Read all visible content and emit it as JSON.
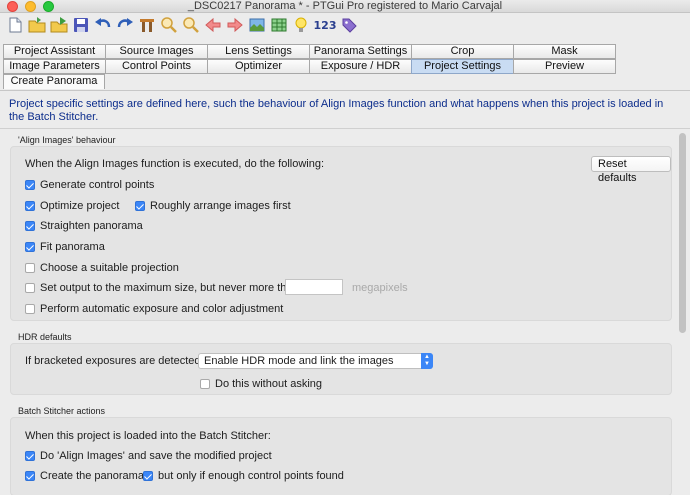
{
  "window": {
    "title": "_DSC0217 Panorama * - PTGui Pro registered to Mario Carvajal"
  },
  "toolbar": {
    "icons": [
      "new-document-icon",
      "open-folder-icon",
      "open-image-icon",
      "save-icon",
      "undo-icon",
      "redo-icon",
      "adjust-icon",
      "zoom-in-icon",
      "zoom-out-icon",
      "previous-icon",
      "next-icon",
      "panorama-editor-icon",
      "table-icon",
      "lightbulb-icon",
      "numbering-icon",
      "tag-icon"
    ],
    "numbering_label": "123"
  },
  "tabs": {
    "row1": [
      "Project Assistant",
      "Source Images",
      "Lens Settings",
      "Panorama Settings",
      "Crop",
      "Mask"
    ],
    "row2": [
      "Image Parameters",
      "Control Points",
      "Optimizer",
      "Exposure / HDR",
      "Project Settings",
      "Preview"
    ],
    "row3": [
      "Create Panorama"
    ]
  },
  "description": "Project specific settings are defined here, such the behaviour of Align Images function and what happens when this project is loaded in the Batch Stitcher.",
  "align": {
    "label": "'Align Images' behaviour",
    "heading": "When the Align Images function is executed, do the following:",
    "reset_button": "Reset defaults",
    "generate_cp": "Generate control points",
    "optimize": "Optimize project",
    "rough_arrange": "Roughly arrange images first",
    "straighten": "Straighten panorama",
    "fit": "Fit panorama",
    "projection": "Choose a suitable projection",
    "max_size": "Set output to the maximum size, but never more than",
    "max_size_value": "",
    "megapixels": "megapixels",
    "auto_exposure": "Perform automatic exposure and color adjustment"
  },
  "hdr": {
    "label": "HDR defaults",
    "bracketed_label": "If bracketed exposures are detected:",
    "selected": "Enable HDR mode and link the images",
    "no_ask": "Do this without asking"
  },
  "batch": {
    "label": "Batch Stitcher actions",
    "heading": "When this project is loaded into the Batch Stitcher:",
    "do_align": "Do 'Align Images' and save the modified project",
    "create": "Create the panorama",
    "only_if": "but only if enough control points found"
  },
  "colors": {
    "accent": "#3b86f7",
    "description_text": "#0c2d8c",
    "active_tab": "#c9dcf3"
  }
}
